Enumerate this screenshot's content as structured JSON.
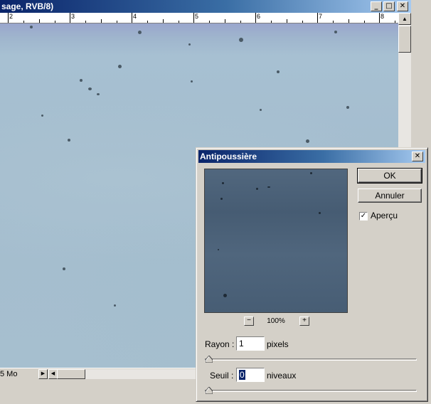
{
  "document_window": {
    "title": "sage, RVB/8)",
    "controls": {
      "minimize": "_",
      "maximize": "□",
      "close": "✕"
    },
    "ruler_labels": [
      "2",
      "3",
      "4",
      "5",
      "6",
      "7",
      "8"
    ],
    "status_size": "5 Mo",
    "status_arrow": "▶",
    "scroll_left": "◀",
    "scroll_up": "▲"
  },
  "dialog": {
    "title": "Antipoussière",
    "close": "✕",
    "zoom": {
      "minus": "−",
      "level": "100%",
      "plus": "+"
    },
    "ok_label": "OK",
    "cancel_label": "Annuler",
    "preview_checkbox": {
      "label": "Aperçu",
      "checked": true,
      "mark": "✓"
    },
    "rayon": {
      "label": "Rayon :",
      "value": "1",
      "unit": "pixels",
      "slider_value": 1
    },
    "seuil": {
      "label": "Seuil :",
      "value": "0",
      "unit": "niveaux",
      "slider_value": 0
    }
  },
  "colors": {
    "title_bar_start": "#0a246a",
    "title_bar_end": "#a6caf0",
    "window_face": "#d4d0c8",
    "image_tint": "#a6bfcf",
    "preview_tint": "#4a6179"
  }
}
